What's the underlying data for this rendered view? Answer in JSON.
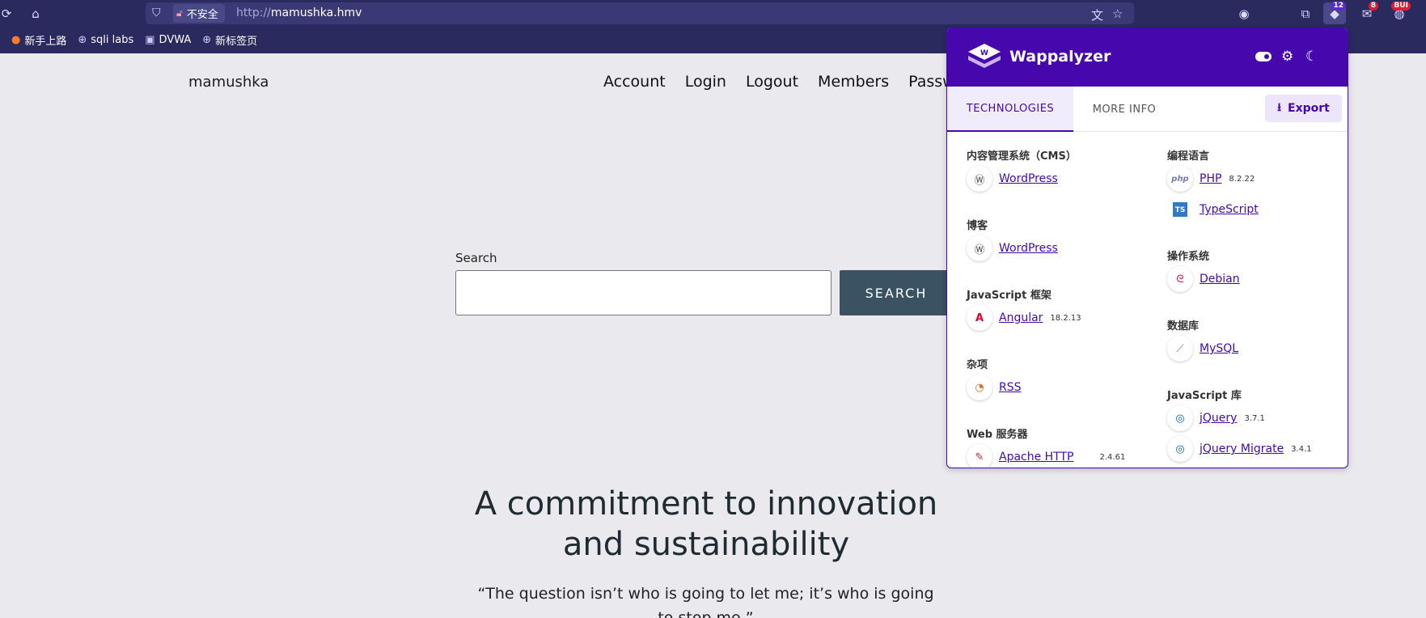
{
  "browser": {
    "url_protocol": "http://",
    "url_host": "mamushka.hmv",
    "insecure_label": "不安全",
    "icons": {
      "reload": "reload-icon",
      "home": "home-icon",
      "shield": "shield-icon",
      "lock": "broken-lock-icon",
      "translate": "translate-icon",
      "star": "star-icon"
    },
    "extensions": [
      {
        "name": "privacy-extension-icon"
      },
      {
        "name": "extensions-puzzle-icon"
      },
      {
        "name": "wappalyzer-extension-icon",
        "badge": "12"
      },
      {
        "name": "mail-extension-icon",
        "badge": "8"
      },
      {
        "name": "bug-extension-icon",
        "badge": "BUI"
      }
    ]
  },
  "bookmarks": [
    {
      "label": "新手上路",
      "icon": "firefox-icon"
    },
    {
      "label": "sqli labs",
      "icon": "globe-icon"
    },
    {
      "label": "DVWA",
      "icon": "page-icon"
    },
    {
      "label": "新标签页",
      "icon": "globe-icon"
    }
  ],
  "site": {
    "title": "mamushka",
    "nav": [
      "Account",
      "Login",
      "Logout",
      "Members",
      "Passwor"
    ],
    "search_label": "Search",
    "search_button": "SEARCH",
    "search_value": "",
    "headline": "A commitment to innovation and sustainability",
    "quote": "“The question isn’t who is going to let me; it’s who is going to stop me.”"
  },
  "wappalyzer": {
    "brand": "Wappalyzer",
    "tabs": {
      "technologies": "TECHNOLOGIES",
      "more_info": "MORE INFO"
    },
    "export_label": "Export",
    "accent": "#4608ad",
    "left_column": [
      {
        "category": "内容管理系统（CMS）",
        "techs": [
          {
            "name": "WordPress",
            "version": "",
            "icon": "wordpress-icon"
          }
        ]
      },
      {
        "category": "博客",
        "techs": [
          {
            "name": "WordPress",
            "version": "",
            "icon": "wordpress-icon"
          }
        ]
      },
      {
        "category": "JavaScript 框架",
        "techs": [
          {
            "name": "Angular",
            "version": "18.2.13",
            "icon": "angular-icon"
          }
        ]
      },
      {
        "category": "杂项",
        "techs": [
          {
            "name": "RSS",
            "version": "",
            "icon": "rss-icon"
          }
        ]
      },
      {
        "category": "Web 服务器",
        "techs": [
          {
            "name": "Apache HTTP",
            "version": "2.4.61",
            "icon": "apache-icon"
          }
        ]
      }
    ],
    "right_column": [
      {
        "category": "编程语言",
        "techs": [
          {
            "name": "PHP",
            "version": "8.2.22",
            "icon": "php-icon"
          },
          {
            "name": "TypeScript",
            "version": "",
            "icon": "typescript-icon"
          }
        ]
      },
      {
        "category": "操作系统",
        "techs": [
          {
            "name": "Debian",
            "version": "",
            "icon": "debian-icon"
          }
        ]
      },
      {
        "category": "数据库",
        "techs": [
          {
            "name": "MySQL",
            "version": "",
            "icon": "mysql-icon"
          }
        ]
      },
      {
        "category": "JavaScript 库",
        "techs": [
          {
            "name": "jQuery",
            "version": "3.7.1",
            "icon": "jquery-icon"
          },
          {
            "name": "jQuery Migrate",
            "version": "3.4.1",
            "icon": "jquery-icon"
          }
        ]
      }
    ]
  }
}
